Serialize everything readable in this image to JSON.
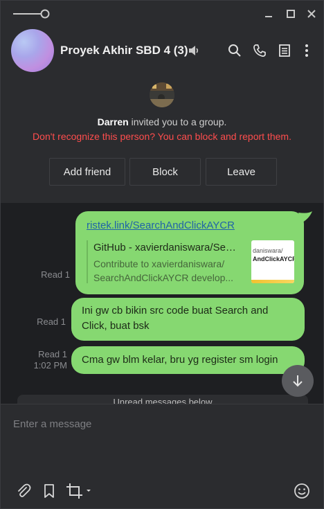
{
  "header": {
    "group_name": "Proyek Akhir SBD 4 (3)"
  },
  "invite": {
    "inviter": "Darren",
    "invite_text": " invited you to a group.",
    "warning": "Don't recognize this person? You can block and report them.",
    "buttons": [
      "Add friend",
      "Block",
      "Leave"
    ]
  },
  "messages": [
    {
      "read": "Read 1",
      "link": "ristek.link/SearchAndClickAYCR",
      "preview_title": "GitHub - xavierdaniswara/SearchAndClickAYCR",
      "preview_desc_1": "Contribute to xavierdaniswara/",
      "preview_desc_2": "SearchAndClickAYCR develop...",
      "thumb_line_1": "daniswara/",
      "thumb_line_2": "AndClickAYCR"
    },
    {
      "read": "Read 1",
      "text_line_1": "Ini gw cb bikin src code buat Search and",
      "text_line_2": "Click, buat bsk"
    },
    {
      "read": "Read 1",
      "time": "1:02 PM",
      "text": "Cma gw blm kelar, bru yg register sm login"
    }
  ],
  "unread_notice": "Unread messages below",
  "composer": {
    "placeholder": "Enter a message"
  },
  "colors": {
    "bubble": "#86d871",
    "warning": "#ff4d4d",
    "link": "#1f63a8"
  },
  "icons": [
    "pin-icon",
    "minimize-icon",
    "maximize-icon",
    "close-icon",
    "speaker-icon",
    "search-icon",
    "phone-icon",
    "notes-icon",
    "more-icon",
    "arrow-down-icon",
    "paperclip-icon",
    "bookmark-icon",
    "crop-icon",
    "emoji-icon"
  ]
}
